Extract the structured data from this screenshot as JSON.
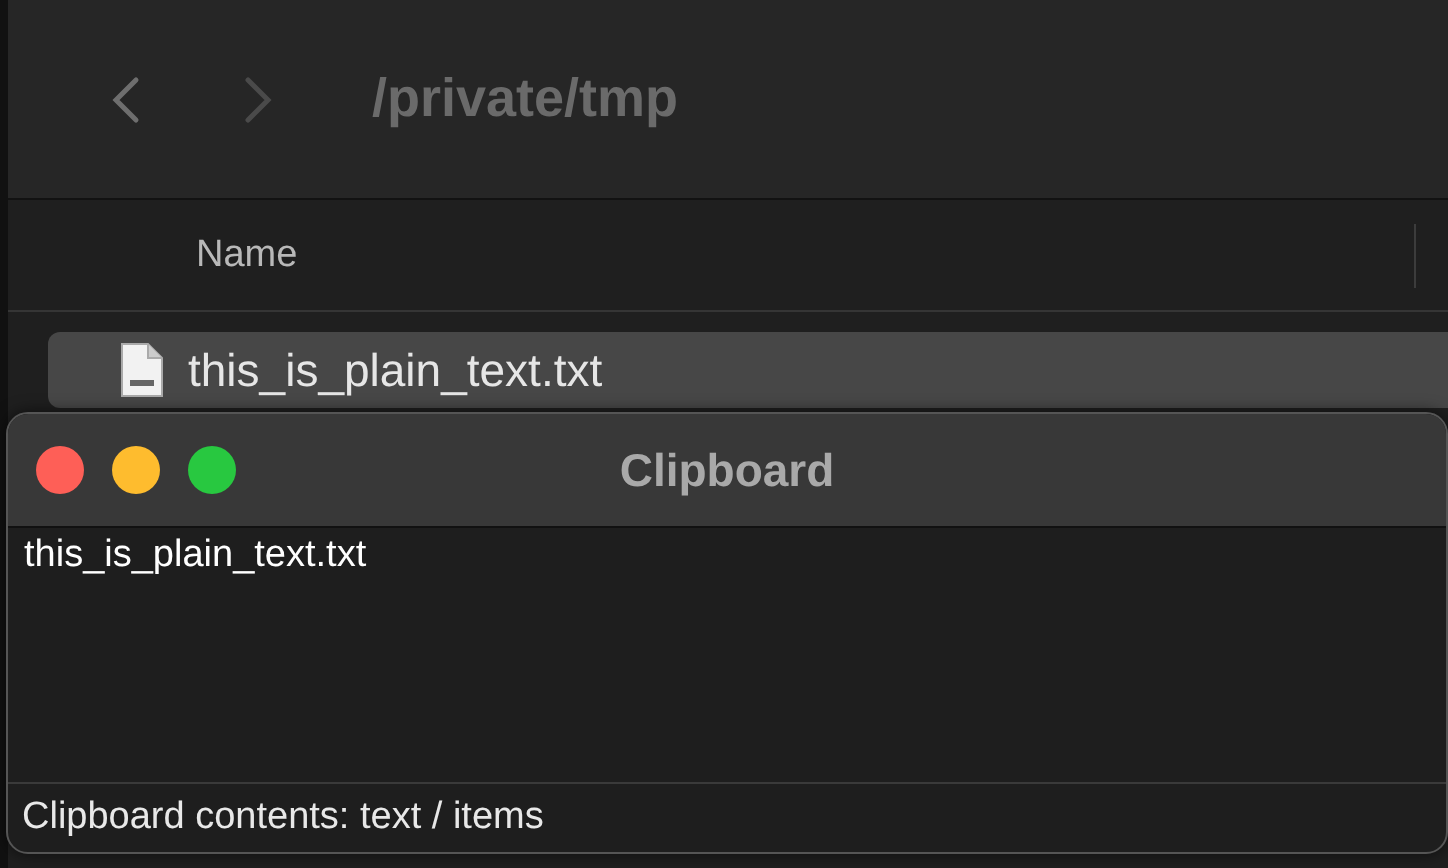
{
  "finder": {
    "path": "/private/tmp",
    "columns": [
      {
        "label": "Name"
      }
    ],
    "rows": [
      {
        "name": "this_is_plain_text.txt",
        "selected": true
      }
    ]
  },
  "clipboard_window": {
    "title": "Clipboard",
    "content": "this_is_plain_text.txt",
    "status_bar": "Clipboard contents: text / items"
  }
}
